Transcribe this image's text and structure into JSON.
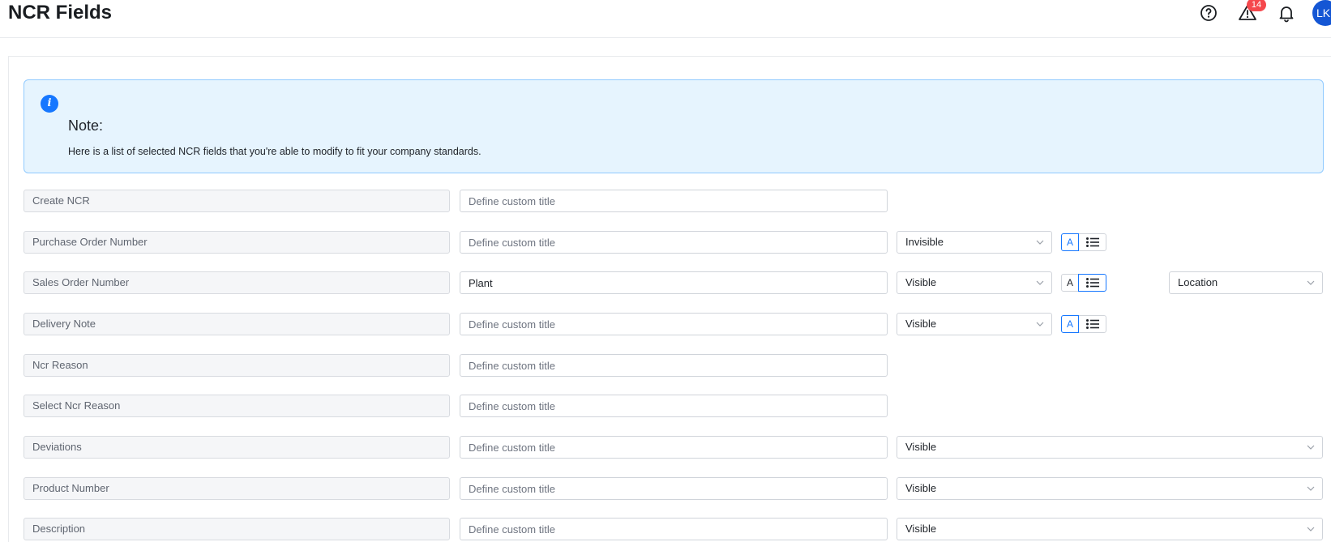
{
  "header": {
    "title": "NCR Fields",
    "warning_count": "14",
    "avatar_initials": "LK"
  },
  "note": {
    "title": "Note:",
    "text": "Here is a list of selected NCR fields that you're able to modify to fit your company standards."
  },
  "placeholder": "Define custom title",
  "rows": [
    {
      "field": "Create NCR",
      "custom": ""
    },
    {
      "field": "Purchase Order Number",
      "custom": "",
      "visibility": "Invisible",
      "mode": "A"
    },
    {
      "field": "Sales Order Number",
      "custom": "Plant",
      "visibility": "Visible",
      "mode": "list",
      "source": "Location"
    },
    {
      "field": "Delivery Note",
      "custom": "",
      "visibility": "Visible",
      "mode": "A"
    },
    {
      "field": "Ncr Reason",
      "custom": ""
    },
    {
      "field": "Select Ncr Reason",
      "custom": ""
    },
    {
      "field": "Deviations",
      "custom": "",
      "visibility": "Visible"
    },
    {
      "field": "Product Number",
      "custom": "",
      "visibility": "Visible"
    },
    {
      "field": "Description",
      "custom": "",
      "visibility": "Visible"
    }
  ],
  "colors": {
    "accent": "#1677ff",
    "note_bg": "#e6f4fe",
    "badge": "#f5484d",
    "avatar": "#1456d4"
  }
}
